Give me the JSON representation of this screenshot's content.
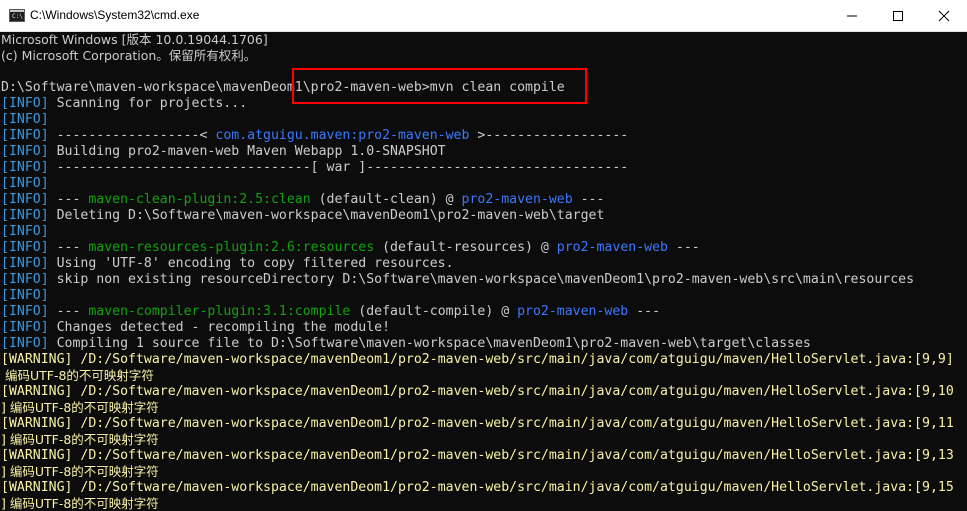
{
  "window": {
    "title": "C:\\Windows\\System32\\cmd.exe",
    "minimize_icon": "minimize-icon",
    "maximize_icon": "maximize-icon",
    "close_icon": "close-icon"
  },
  "console": {
    "lines": [
      {
        "text": "Microsoft Windows [版本 10.0.19044.1706]"
      },
      {
        "text": "(c) Microsoft Corporation。保留所有权利。"
      },
      {
        "text": ""
      },
      {
        "prompt": "D:\\Software\\maven-workspace\\mavenDeom1\\pro2-maven-web>",
        "command": "mvn clean compile"
      },
      {
        "tag": "[INFO]",
        "text": " Scanning for projects..."
      },
      {
        "tag": "[INFO]",
        "text": ""
      },
      {
        "tag": "[INFO]",
        "text_a": " ------------------< ",
        "text_b": "com.atguigu.maven:pro2-maven-web",
        "text_c": " >------------------"
      },
      {
        "tag": "[INFO]",
        "text": " Building pro2-maven-web Maven Webapp 1.0-SNAPSHOT"
      },
      {
        "tag": "[INFO]",
        "text": " --------------------------------[ war ]---------------------------------"
      },
      {
        "tag": "[INFO]",
        "text": ""
      },
      {
        "tag": "[INFO]",
        "text_a": " --- ",
        "text_b": "maven-clean-plugin:2.5:clean",
        "text_c": " (default-clean) @ ",
        "text_d": "pro2-maven-web",
        "text_e": " ---"
      },
      {
        "tag": "[INFO]",
        "text": " Deleting D:\\Software\\maven-workspace\\mavenDeom1\\pro2-maven-web\\target"
      },
      {
        "tag": "[INFO]",
        "text": ""
      },
      {
        "tag": "[INFO]",
        "text_a": " --- ",
        "text_b": "maven-resources-plugin:2.6:resources",
        "text_c": " (default-resources) @ ",
        "text_d": "pro2-maven-web",
        "text_e": " ---"
      },
      {
        "tag": "[INFO]",
        "text": " Using 'UTF-8' encoding to copy filtered resources."
      },
      {
        "tag": "[INFO]",
        "text": " skip non existing resourceDirectory D:\\Software\\maven-workspace\\mavenDeom1\\pro2-maven-web\\src\\main\\resources"
      },
      {
        "tag": "[INFO]",
        "text": ""
      },
      {
        "tag": "[INFO]",
        "text_a": " --- ",
        "text_b": "maven-compiler-plugin:3.1:compile",
        "text_c": " (default-compile) @ ",
        "text_d": "pro2-maven-web",
        "text_e": " ---"
      },
      {
        "tag": "[INFO]",
        "text": " Changes detected - recompiling the module!"
      },
      {
        "tag": "[INFO]",
        "text": " Compiling 1 source file to D:\\Software\\maven-workspace\\mavenDeom1\\pro2-maven-web\\target\\classes"
      },
      {
        "tag": "[WARNING]",
        "text": " /D:/Software/maven-workspace/mavenDeom1/pro2-maven-web/src/main/java/com/atguigu/maven/HelloServlet.java:[9,9]"
      },
      {
        "text": " 编码UTF-8的不可映射字符"
      },
      {
        "tag": "[WARNING]",
        "text": " /D:/Software/maven-workspace/mavenDeom1/pro2-maven-web/src/main/java/com/atguigu/maven/HelloServlet.java:[9,10"
      },
      {
        "text": "] 编码UTF-8的不可映射字符"
      },
      {
        "tag": "[WARNING]",
        "text": " /D:/Software/maven-workspace/mavenDeom1/pro2-maven-web/src/main/java/com/atguigu/maven/HelloServlet.java:[9,11"
      },
      {
        "text": "] 编码UTF-8的不可映射字符"
      },
      {
        "tag": "[WARNING]",
        "text": " /D:/Software/maven-workspace/mavenDeom1/pro2-maven-web/src/main/java/com/atguigu/maven/HelloServlet.java:[9,13"
      },
      {
        "text": "] 编码UTF-8的不可映射字符"
      },
      {
        "tag": "[WARNING]",
        "text": " /D:/Software/maven-workspace/mavenDeom1/pro2-maven-web/src/main/java/com/atguigu/maven/HelloServlet.java:[9,15"
      },
      {
        "text": "] 编码UTF-8的不可映射字符"
      }
    ]
  }
}
